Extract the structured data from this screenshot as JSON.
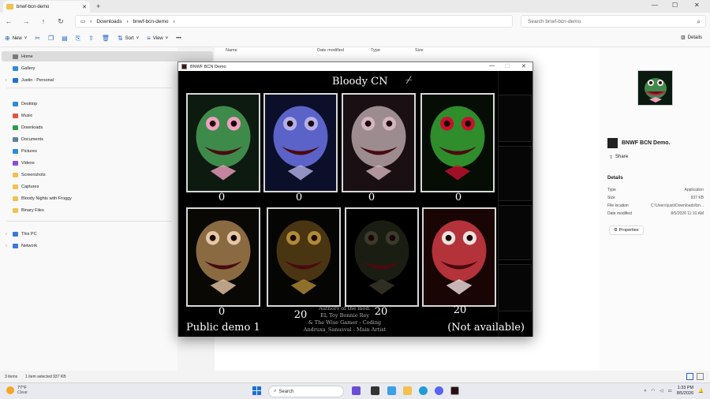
{
  "explorer": {
    "tab_title": "bnwf-bcn-demo",
    "breadcrumb": [
      "Downloads",
      "bnwf-bcn-demo"
    ],
    "search_placeholder": "Search bnwf-bcn-demo",
    "toolbar": {
      "new_label": "New",
      "sort_label": "Sort",
      "view_label": "View",
      "details_label": "Details"
    },
    "sidebar": {
      "items": [
        {
          "label": "Home",
          "icon": "home-icon"
        },
        {
          "label": "Gallery",
          "icon": "gallery-icon"
        },
        {
          "label": "Justin - Personal",
          "icon": "cloud-icon"
        },
        {
          "label": "Desktop",
          "icon": "desktop-icon"
        },
        {
          "label": "Music",
          "icon": "music-icon"
        },
        {
          "label": "Downloads",
          "icon": "download-icon"
        },
        {
          "label": "Documents",
          "icon": "document-icon"
        },
        {
          "label": "Pictures",
          "icon": "pictures-icon"
        },
        {
          "label": "Videos",
          "icon": "videos-icon"
        },
        {
          "label": "Screenshots",
          "icon": "folder-icon"
        },
        {
          "label": "Captures",
          "icon": "folder-icon"
        },
        {
          "label": "Bloody Nights with Froggy",
          "icon": "folder-icon"
        },
        {
          "label": "Binary Files",
          "icon": "folder-icon"
        },
        {
          "label": "This PC",
          "icon": "pc-icon"
        },
        {
          "label": "Network",
          "icon": "network-icon"
        }
      ]
    },
    "columns": [
      "Name",
      "Date modified",
      "Type",
      "Size"
    ],
    "details_pane": {
      "file_title": "BNWF BCN Demo.",
      "share_label": "Share",
      "section_label": "Details",
      "rows": [
        {
          "key": "Type",
          "value": "Application"
        },
        {
          "key": "Size",
          "value": "937 KB"
        },
        {
          "key": "File location",
          "value": "C:\\Users\\justi\\Downloads\\bn..."
        },
        {
          "key": "Date modified",
          "value": "8/5/2026 11:10 AM"
        }
      ],
      "properties_label": "Properties"
    },
    "status": {
      "items_count": "3 items",
      "selection": "1 item selected  937 KB"
    }
  },
  "game_window": {
    "title": "BNWF BCN Demo",
    "stage_title": "Bloody CN",
    "cards": [
      {
        "name": "green-frog",
        "count": "0",
        "colors": [
          "#0d1a10",
          "#3e8a4a",
          "#f0a0c0"
        ]
      },
      {
        "name": "blue-cat",
        "count": "0",
        "colors": [
          "#0c0f2a",
          "#5b62c8",
          "#b6b0e8"
        ]
      },
      {
        "name": "white-bear",
        "count": "0",
        "colors": [
          "#1a0f12",
          "#9c8c90",
          "#d4b5bf"
        ]
      },
      {
        "name": "green-crocodile",
        "count": "0",
        "colors": [
          "#050d05",
          "#2f8d2b",
          "#c8102e"
        ]
      },
      {
        "name": "curly-doll",
        "count": "0",
        "colors": [
          "#0a0805",
          "#8a6a40",
          "#e6c8a8"
        ]
      },
      {
        "name": "dark-frog",
        "count": "20",
        "colors": [
          "#050503",
          "#4a3512",
          "#b08a36"
        ]
      },
      {
        "name": "shadow-creature",
        "count": "20",
        "colors": [
          "#000000",
          "#1a1e12",
          "#3c3a2a"
        ]
      },
      {
        "name": "clown-king",
        "count": "20",
        "colors": [
          "#1a0505",
          "#b4323a",
          "#f0e0e0"
        ]
      }
    ],
    "credits": [
      "Authors of the mod:",
      "EL Toy Bonnie Rey",
      "& The Wise Gamer - Coding",
      "Andruxa_Sanusval - Main Artist"
    ],
    "footer_left": "Public demo 1",
    "footer_right": "(Not available)"
  },
  "taskbar": {
    "weather_temp": "77°F",
    "weather_cond": "Clear",
    "search_label": "Search",
    "time": "1:33 PM",
    "date": "8/5/2026"
  }
}
